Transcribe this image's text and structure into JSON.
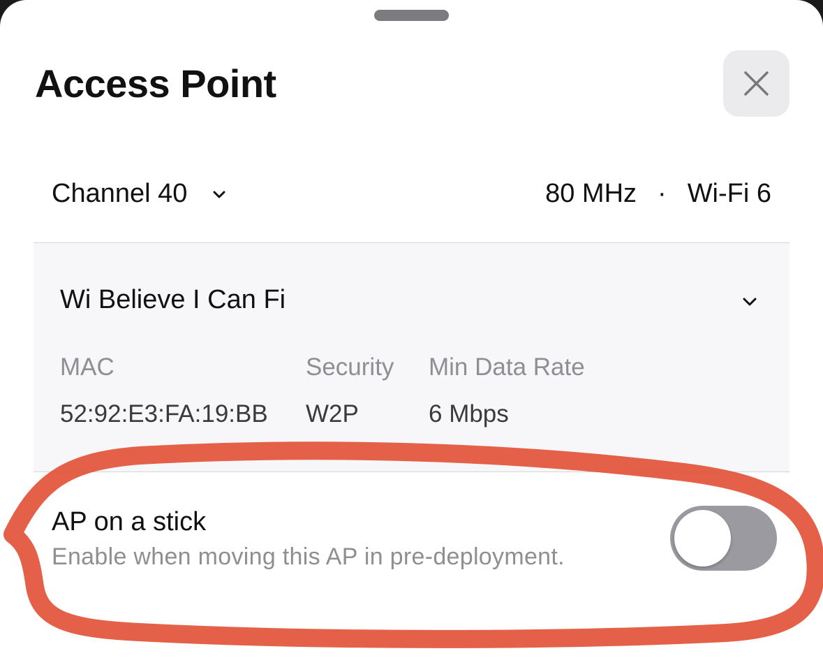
{
  "sheet": {
    "title": "Access Point",
    "close_icon": "close-icon"
  },
  "radio": {
    "channel": "Channel 40",
    "bandwidth": "80 MHz",
    "separator": "·",
    "standard": "Wi-Fi 6"
  },
  "network": {
    "ssid": "Wi Believe I Can Fi",
    "mac_label": "MAC",
    "mac_value": "52:92:E3:FA:19:BB",
    "security_label": "Security",
    "security_value": "W2P",
    "rate_label": "Min Data Rate",
    "rate_value": "6 Mbps"
  },
  "stick": {
    "title": "AP on a stick",
    "description": "Enable when moving this AP in pre-deployment.",
    "enabled": false
  },
  "colors": {
    "annotation": "#e2533a",
    "toggle_off": "#9a9aa0",
    "panel_bg": "#f7f7f9"
  }
}
